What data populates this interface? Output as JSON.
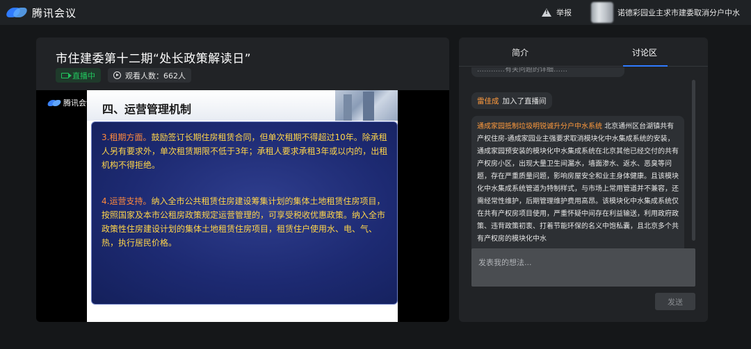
{
  "app": {
    "name": "腾讯会议"
  },
  "topbar": {
    "report_label": "举报",
    "username": "诺德彩园业主求市建委取消分户中水"
  },
  "stream": {
    "title": "市住建委第十二期“处长政策解读日”",
    "live_label": "直播中",
    "viewers_label": "观看人数：662人"
  },
  "video": {
    "overlay_logo": "腾讯会议",
    "slide": {
      "heading": "四、运营管理机制",
      "p1_keyword": "3.租期方面。",
      "p1_text": "鼓励签订长期住房租赁合同，但单次租期不得超过10年。除承租人另有要求外，单次租赁期限不低于3年；承租人要求承租3年或以内的，出租机构不得拒绝。",
      "p2_keyword": "4.运营支持。",
      "p2_text": "纳入全市公共租赁住房建设筹集计划的集体土地租赁住房项目，按照国家及本市公租房政策规定运营管理的，可享受税收优惠政策。纳入全市政策性住房建设计划的集体土地租赁住房项目，租赁住户使用水、电、气、热，执行居民价格。"
    }
  },
  "tabs": [
    {
      "label": "简介"
    },
    {
      "label": "讨论区"
    }
  ],
  "chat": {
    "cut_text": "…………有关问题的详细……",
    "join": {
      "name": "雷佳成",
      "text": "加入了直播间"
    },
    "long": {
      "name": "通成家园抵制垃圾明锐诚升分户中水系统",
      "text": "北京通州区台湖镇共有产权住房-通成家园业主强要求取消模块化中水集成系统的安装，通成家园预安装的模块化中水集成系统在北京其他已经交付的共有产权房小区，出现大量卫生间漏水，墙面渗水、返水、恶臭等问题，存在严重质量问题，影响房屋安全和业主身体健康。且该模块化中水集成系统管道为特制样式，与市场上常用管道并不兼容，还需经常性维护，后期管理维护费用高昂。该模块化中水集成系统仅在共有产权房项目使用，严重怀疑中间存在利益输送，利用政府政策、违背政策初衷、打着节能环保的名义中饱私囊，且北京多个共有产权房的模块化中水"
    }
  },
  "composer": {
    "placeholder": "发表我的想法...",
    "send_label": "发送"
  },
  "colors": {
    "accent": "#2f7bff",
    "live_green": "#22c55e",
    "name_orange": "#ff9a3d",
    "slide_text": "#ffd54a",
    "slide_keyword": "#ff8a3d"
  }
}
